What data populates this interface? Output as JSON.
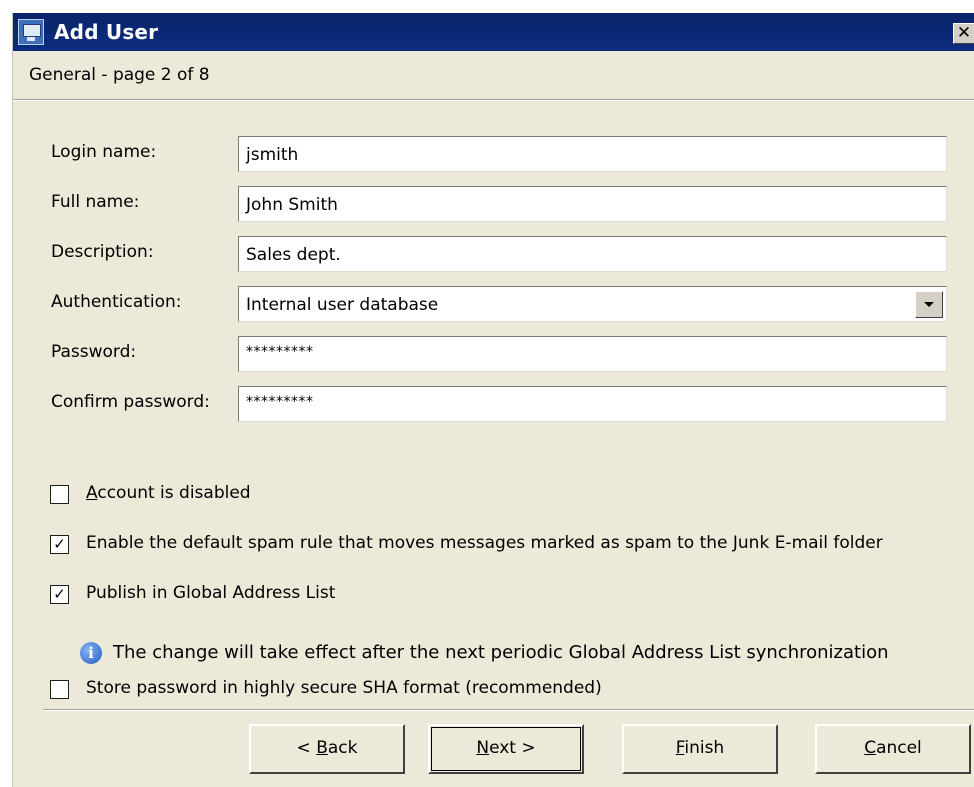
{
  "window": {
    "title": "Add User",
    "close_glyph": "✕",
    "icon": "user-admin-icon"
  },
  "page_header": "General - page 2 of 8",
  "form": {
    "login_label": "Login name:",
    "login_value": "jsmith",
    "fullname_label": "Full name:",
    "fullname_value": "John Smith",
    "description_label": "Description:",
    "description_value": "Sales dept.",
    "auth_label": "Authentication:",
    "auth_value": "Internal user database",
    "password_label": "Password:",
    "password_value": "*********",
    "confirm_label": "Confirm password:",
    "confirm_value": "*********"
  },
  "options": {
    "account_disabled": {
      "pre": "",
      "u": "A",
      "post": "ccount is disabled",
      "checked": false
    },
    "spam_rule": {
      "label": "Enable the default spam rule that moves messages marked as spam to the Junk E-mail folder",
      "checked": true
    },
    "publish_gal": {
      "label": "Publish in Global Address List",
      "checked": true
    },
    "gal_info": "The change will take effect after the next periodic Global Address List synchronization",
    "sha_format": {
      "label": "Store password in highly secure SHA format (recommended)",
      "checked": false
    }
  },
  "check_glyph": "✓",
  "buttons": {
    "back": {
      "pre": "< ",
      "u": "B",
      "post": "ack"
    },
    "next": {
      "pre": "",
      "u": "N",
      "post": "ext >"
    },
    "finish": {
      "pre": "",
      "u": "F",
      "post": "inish"
    },
    "cancel": {
      "pre": "",
      "u": "C",
      "post": "ancel"
    }
  }
}
